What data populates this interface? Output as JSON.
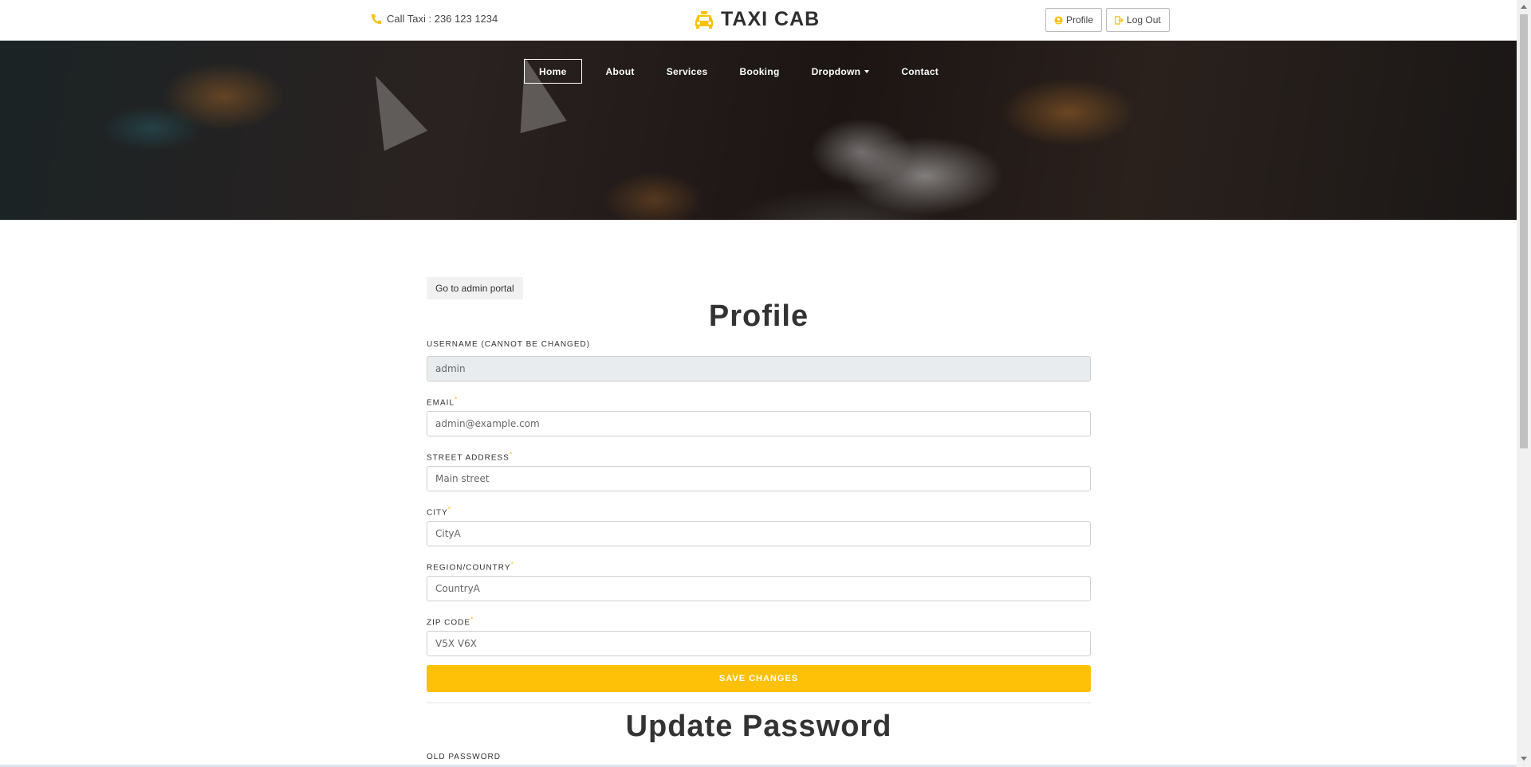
{
  "topbar": {
    "call_text": "Call Taxi : 236 123 1234",
    "brand": "TAXI CAB",
    "profile_label": "Profile",
    "logout_label": "Log Out",
    "accent_color": "#ffc107"
  },
  "nav": {
    "items": [
      {
        "label": "Home"
      },
      {
        "label": "About"
      },
      {
        "label": "Services"
      },
      {
        "label": "Booking"
      },
      {
        "label": "Dropdown"
      },
      {
        "label": "Contact"
      }
    ]
  },
  "main": {
    "admin_button": "Go to admin portal",
    "profile_title": "Profile",
    "fields": {
      "username": {
        "label": "USERNAME (CANNOT BE CHANGED)",
        "value": "admin"
      },
      "email": {
        "label": "EMAIL",
        "placeholder": "admin@example.com"
      },
      "street": {
        "label": "STREET ADDRESS",
        "placeholder": "Main street"
      },
      "city": {
        "label": "CITY",
        "placeholder": "CityA"
      },
      "region": {
        "label": "REGION/COUNTRY",
        "placeholder": "CountryA"
      },
      "zip": {
        "label": "ZIP CODE",
        "placeholder": "V5X V6X"
      }
    },
    "required_mark": "*",
    "save_label": "SAVE CHANGES",
    "password_title": "Update Password",
    "old_password_label": "OLD PASSWORD"
  }
}
